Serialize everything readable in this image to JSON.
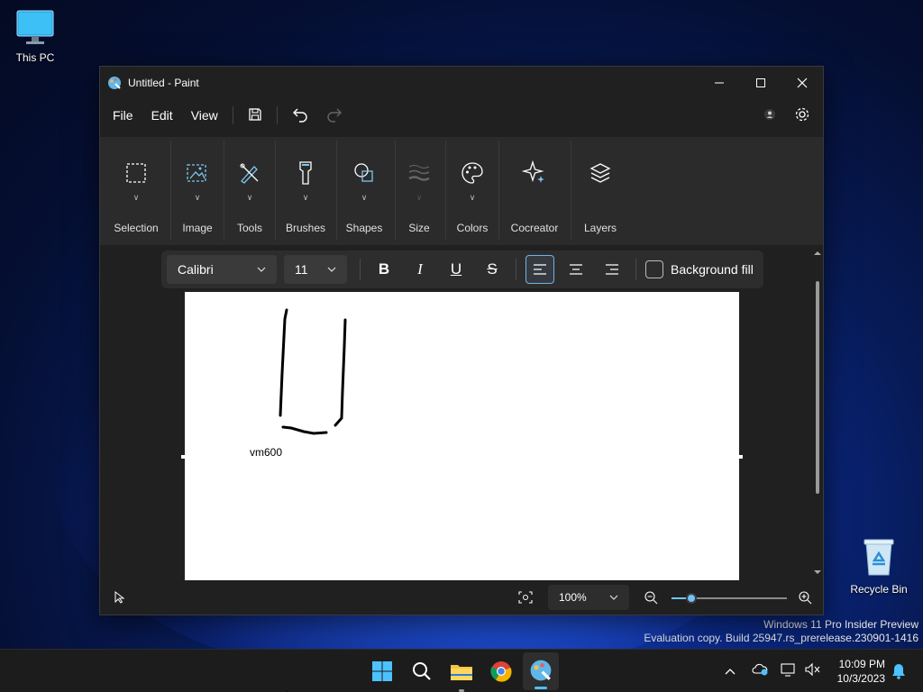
{
  "desktop": {
    "this_pc_label": "This PC",
    "recycle_bin_label": "Recycle Bin",
    "watermark_line1": "Windows 11 Pro Insider Preview",
    "watermark_line2": "Evaluation copy. Build 25947.rs_prerelease.230901-1416"
  },
  "window": {
    "title": "Untitled - Paint",
    "menu": {
      "file": "File",
      "edit": "Edit",
      "view": "View"
    }
  },
  "ribbon": {
    "groups": [
      {
        "label": "Selection",
        "icon": "selection-icon"
      },
      {
        "label": "Image",
        "icon": "image-icon"
      },
      {
        "label": "Tools",
        "icon": "tools-icon"
      },
      {
        "label": "Brushes",
        "icon": "brush-icon"
      },
      {
        "label": "Shapes",
        "icon": "shapes-icon"
      },
      {
        "label": "Size",
        "icon": "size-icon"
      },
      {
        "label": "Colors",
        "icon": "palette-icon"
      },
      {
        "label": "Cocreator",
        "icon": "sparkle-icon"
      },
      {
        "label": "Layers",
        "icon": "layers-icon"
      }
    ]
  },
  "text_toolbar": {
    "font": "Calibri",
    "size": "11",
    "background_fill_label": "Background fill",
    "background_fill_checked": false,
    "alignment": "left"
  },
  "canvas": {
    "text": "vm600"
  },
  "status": {
    "zoom": "100%",
    "zoom_slider_fraction": 0.17
  },
  "taskbar": {
    "time": "10:09 PM",
    "date": "10/3/2023"
  }
}
